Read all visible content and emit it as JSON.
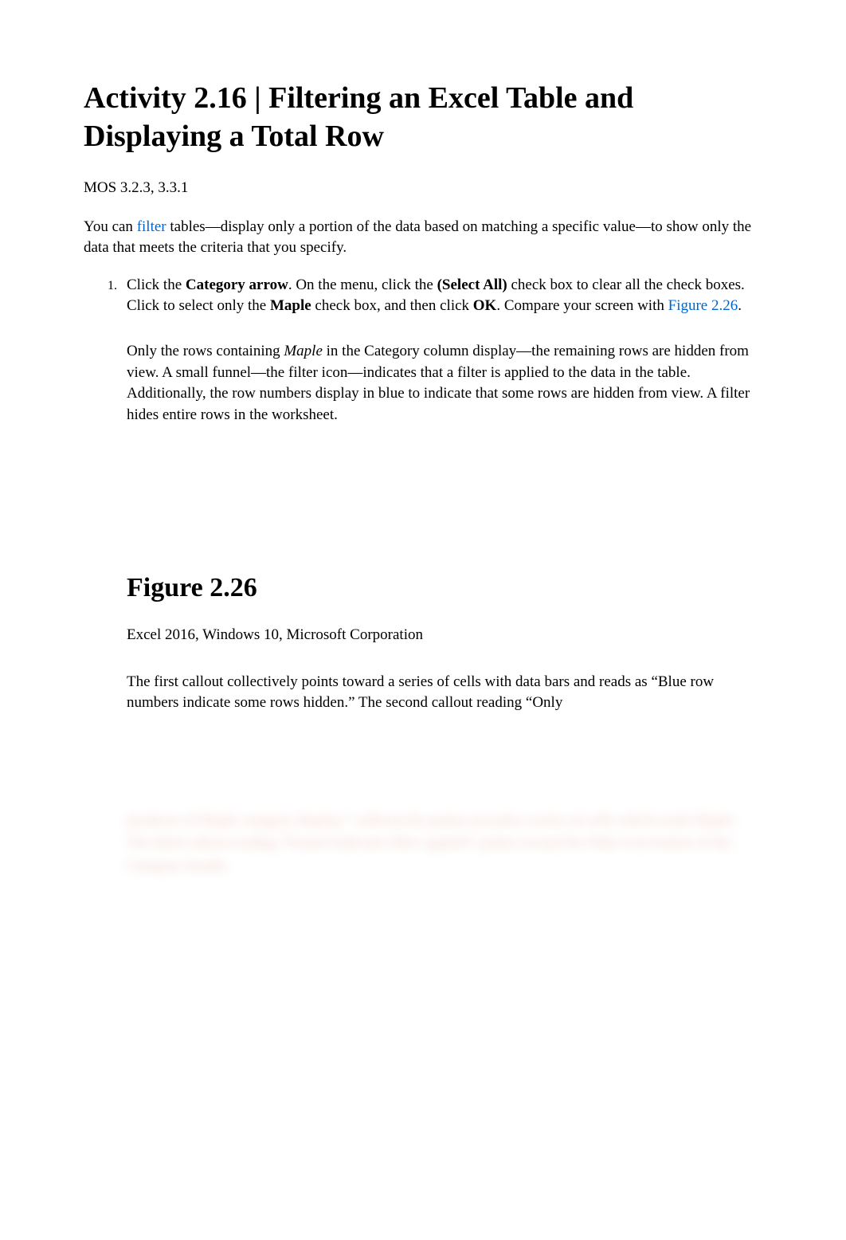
{
  "heading": "Activity 2.16 | Filtering an Excel Table and Displaying a Total Row",
  "mos": "MOS 3.2.3, 3.3.1",
  "intro": {
    "prefix": "You can ",
    "link": "filter",
    "suffix": " tables—display only a portion of the data based on matching a specific value—to show only the data that meets the criteria that you specify."
  },
  "step": {
    "p1a": "Click the ",
    "p1b": "Category arrow",
    "p1c": ". On the menu, click the ",
    "p1d": "(Select All)",
    "p1e": " check box to clear all the check boxes. Click to select only the ",
    "p1f": "Maple",
    "p1g": " check box, and then click ",
    "p1h": "OK",
    "p1i": ". Compare your screen with ",
    "p1link": "Figure 2.26",
    "p1j": "."
  },
  "result": {
    "a": "Only the rows containing ",
    "b": "Maple",
    "c": " in the Category column display—the remaining rows are hidden from view. A small funnel—the filter icon—indicates that a filter is applied to the data in the table. Additionally, the row numbers display in blue to indicate that some rows are hidden from view. A filter hides entire rows in the worksheet."
  },
  "figure": {
    "title": "Figure 2.26",
    "caption": "Excel 2016, Windows 10, Microsoft Corporation",
    "desc": "The first callout collectively points toward a series of cells with data bars and reads as “Blue row numbers indicate some rows hidden.” The second callout reading “Only"
  },
  "blurred": "products of Maple category display,” collectively points towards a series of cells which reads Maple. The third callout reading “Funnel indicates filter applied” points toward the Filter icon button of the Category header."
}
